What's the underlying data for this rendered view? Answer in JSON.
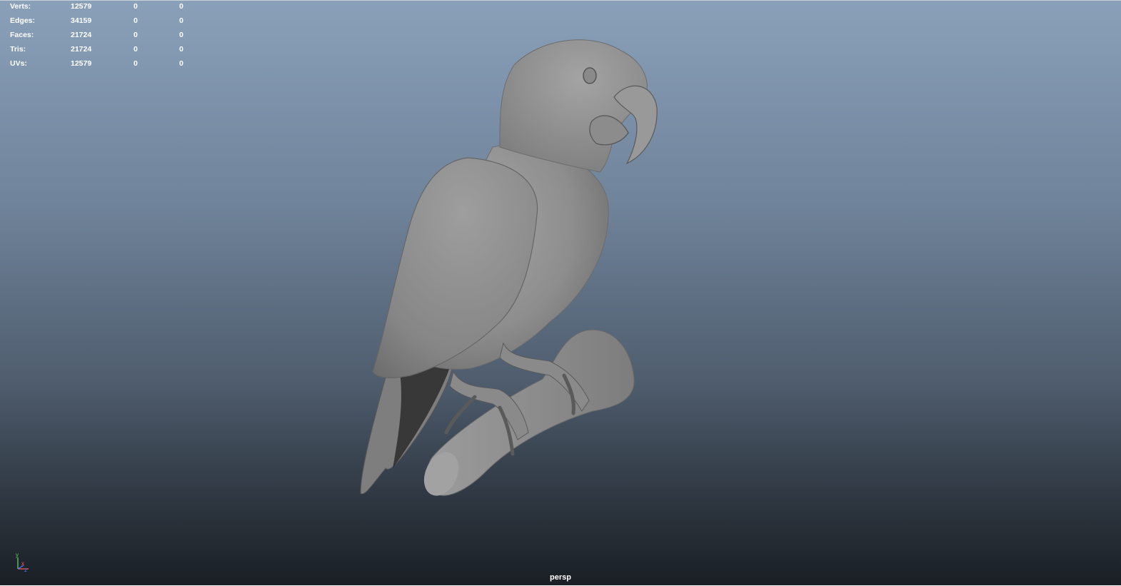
{
  "hud": {
    "rows": [
      {
        "label": "Verts:",
        "v1": "12579",
        "v2": "0",
        "v3": "0"
      },
      {
        "label": "Edges:",
        "v1": "34159",
        "v2": "0",
        "v3": "0"
      },
      {
        "label": "Faces:",
        "v1": "21724",
        "v2": "0",
        "v3": "0"
      },
      {
        "label": "Tris:",
        "v1": "21724",
        "v2": "0",
        "v3": "0"
      },
      {
        "label": "UVs:",
        "v1": "12579",
        "v2": "0",
        "v3": "0"
      }
    ]
  },
  "axis": {
    "y": "y",
    "x": "x",
    "z": "z"
  },
  "camera": {
    "name": "persp"
  },
  "colors": {
    "model": "#8f8f8f",
    "bg_top": "#8aa0b9",
    "bg_bottom": "#1a1f25"
  }
}
